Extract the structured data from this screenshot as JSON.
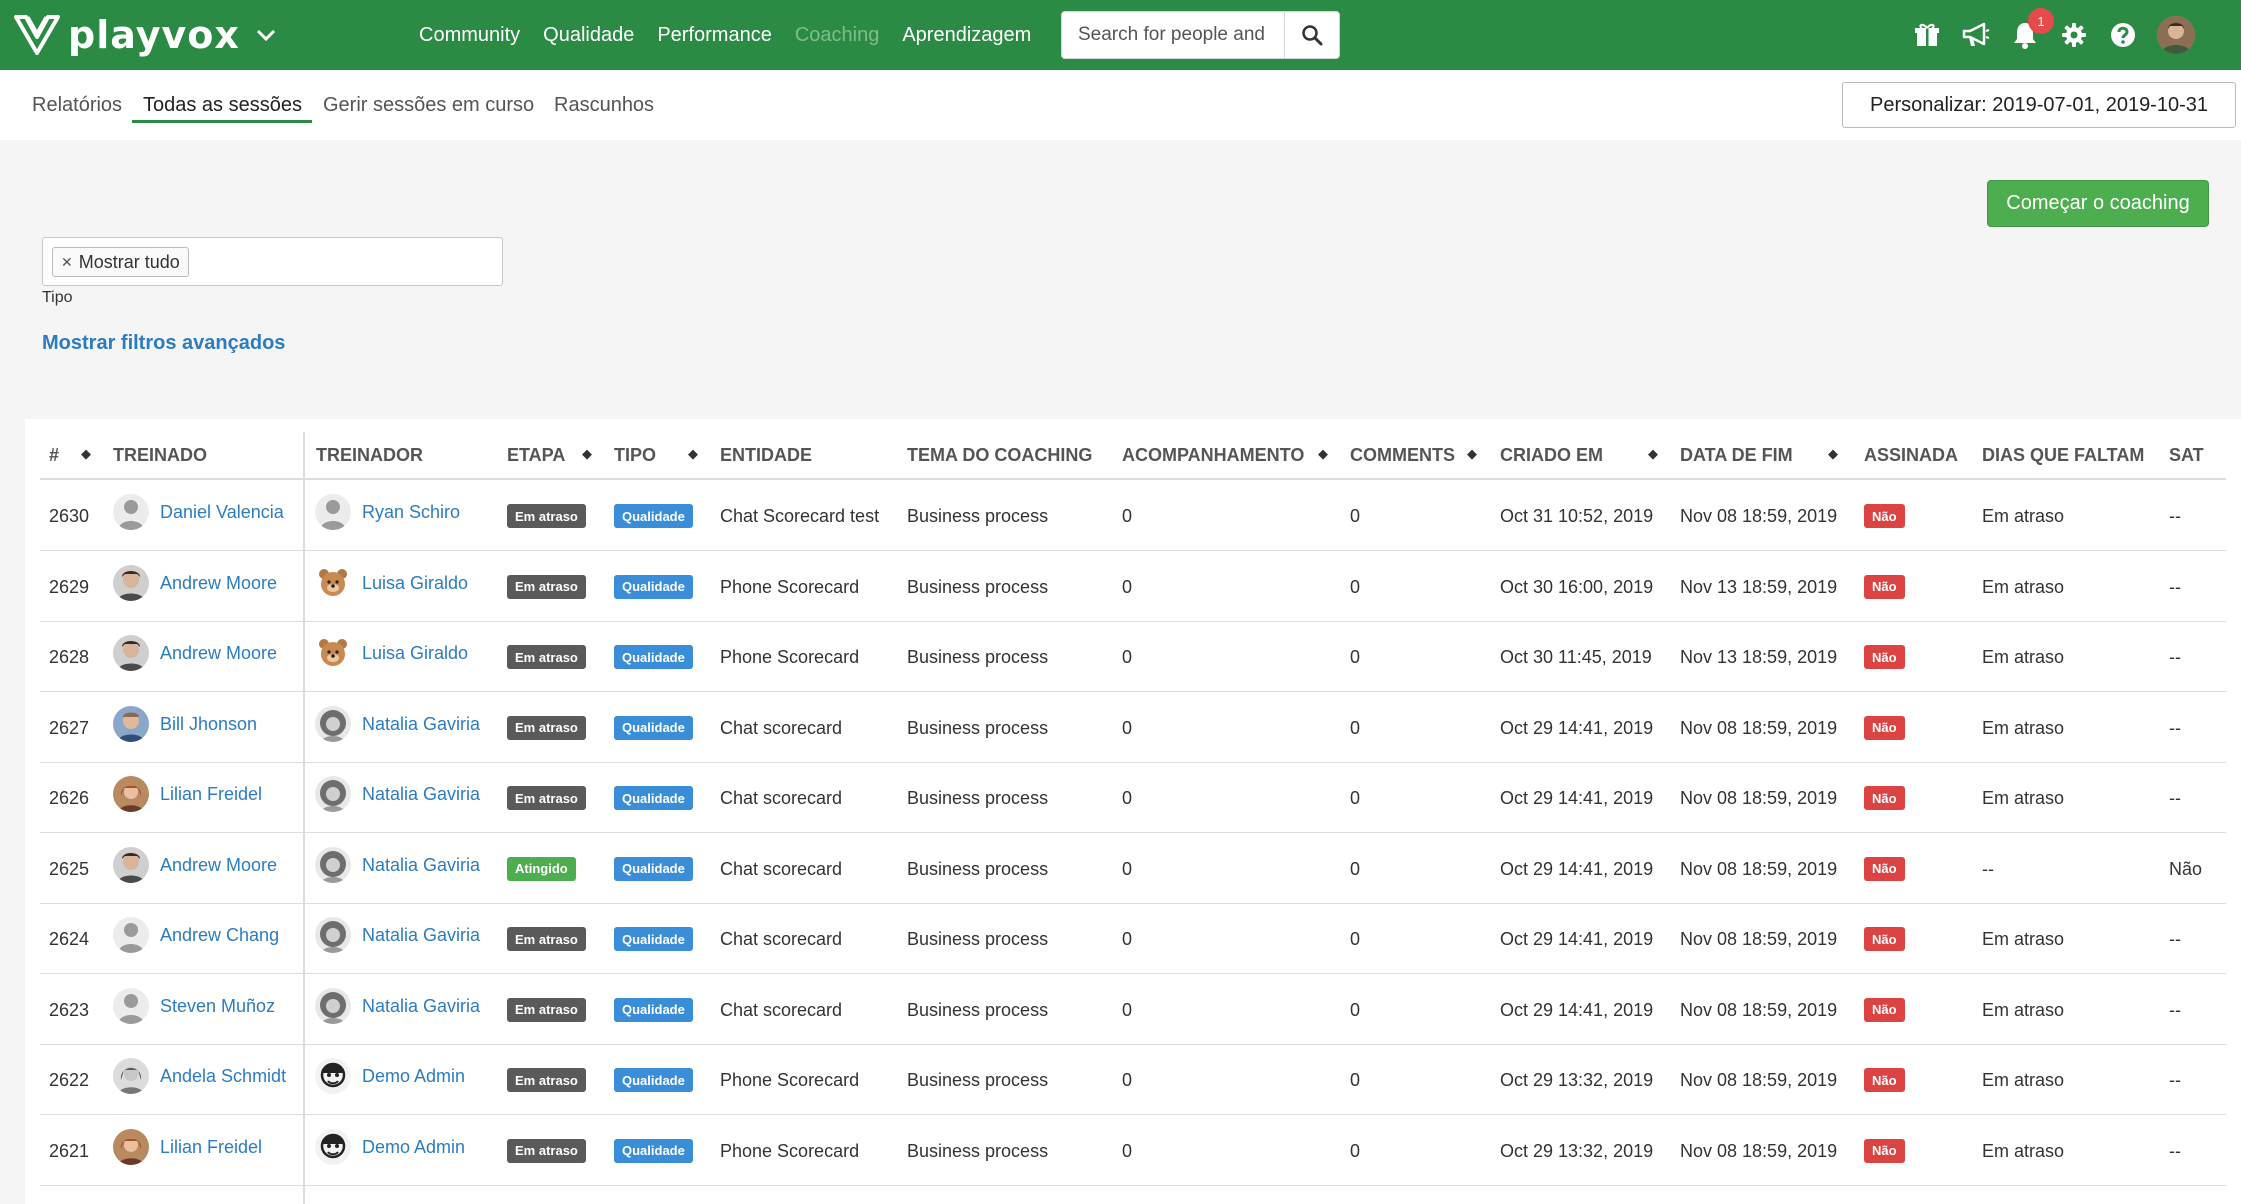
{
  "brand": {
    "name": "playvox"
  },
  "nav": {
    "items": [
      {
        "label": "Community"
      },
      {
        "label": "Qualidade"
      },
      {
        "label": "Performance"
      },
      {
        "label": "Coaching"
      },
      {
        "label": "Aprendizagem"
      }
    ]
  },
  "search": {
    "placeholder": "Search for people and"
  },
  "notifications": {
    "count": "1"
  },
  "subnav": {
    "tabs": [
      {
        "label": "Relatórios"
      },
      {
        "label": "Todas as sessões"
      },
      {
        "label": "Gerir sessões em curso"
      },
      {
        "label": "Rascunhos"
      }
    ],
    "date_range": "Personalizar: 2019-07-01, 2019-10-31"
  },
  "actions": {
    "start_coaching": "Começar o coaching"
  },
  "filters": {
    "chip_label": "Mostrar tudo",
    "type_label": "Tipo",
    "advanced_link": "Mostrar filtros avançados"
  },
  "table": {
    "headers": {
      "id": "#",
      "trainee": "TREINADO",
      "trainer": "TREINADOR",
      "stage": "ETAPA",
      "type": "TIPO",
      "entity": "ENTIDADE",
      "topic": "TEMA DO COACHING",
      "followup": "ACOMPANHAMENTO",
      "comments": "COMMENTS",
      "created": "CRIADO EM",
      "end_date": "DATA DE FIM",
      "signed": "ASSINADA",
      "days_left": "DIAS QUE FALTAM",
      "sat": "SAT"
    },
    "rows": [
      {
        "id": "2630",
        "trainee": "Daniel Valencia",
        "trainer": "Ryan Schiro",
        "stage": "Em atraso",
        "type": "Qualidade",
        "entity": "Chat Scorecard test",
        "topic": "Business process",
        "followup": "0",
        "comments": "0",
        "created": "Oct 31 10:52, 2019",
        "end_date": "Nov 08 18:59, 2019",
        "signed": "Não",
        "days_left": "Em atraso",
        "sat": "--"
      },
      {
        "id": "2629",
        "trainee": "Andrew Moore",
        "trainer": "Luisa Giraldo",
        "stage": "Em atraso",
        "type": "Qualidade",
        "entity": "Phone Scorecard",
        "topic": "Business process",
        "followup": "0",
        "comments": "0",
        "created": "Oct 30 16:00, 2019",
        "end_date": "Nov 13 18:59, 2019",
        "signed": "Não",
        "days_left": "Em atraso",
        "sat": "--"
      },
      {
        "id": "2628",
        "trainee": "Andrew Moore",
        "trainer": "Luisa Giraldo",
        "stage": "Em atraso",
        "type": "Qualidade",
        "entity": "Phone Scorecard",
        "topic": "Business process",
        "followup": "0",
        "comments": "0",
        "created": "Oct 30 11:45, 2019",
        "end_date": "Nov 13 18:59, 2019",
        "signed": "Não",
        "days_left": "Em atraso",
        "sat": "--"
      },
      {
        "id": "2627",
        "trainee": "Bill Jhonson",
        "trainer": "Natalia Gaviria",
        "stage": "Em atraso",
        "type": "Qualidade",
        "entity": "Chat scorecard",
        "topic": "Business process",
        "followup": "0",
        "comments": "0",
        "created": "Oct 29 14:41, 2019",
        "end_date": "Nov 08 18:59, 2019",
        "signed": "Não",
        "days_left": "Em atraso",
        "sat": "--"
      },
      {
        "id": "2626",
        "trainee": "Lilian Freidel",
        "trainer": "Natalia Gaviria",
        "stage": "Em atraso",
        "type": "Qualidade",
        "entity": "Chat scorecard",
        "topic": "Business process",
        "followup": "0",
        "comments": "0",
        "created": "Oct 29 14:41, 2019",
        "end_date": "Nov 08 18:59, 2019",
        "signed": "Não",
        "days_left": "Em atraso",
        "sat": "--"
      },
      {
        "id": "2625",
        "trainee": "Andrew Moore",
        "trainer": "Natalia Gaviria",
        "stage": "Atingido",
        "type": "Qualidade",
        "entity": "Chat scorecard",
        "topic": "Business process",
        "followup": "0",
        "comments": "0",
        "created": "Oct 29 14:41, 2019",
        "end_date": "Nov 08 18:59, 2019",
        "signed": "Não",
        "days_left": "--",
        "sat": "Não"
      },
      {
        "id": "2624",
        "trainee": "Andrew Chang",
        "trainer": "Natalia Gaviria",
        "stage": "Em atraso",
        "type": "Qualidade",
        "entity": "Chat scorecard",
        "topic": "Business process",
        "followup": "0",
        "comments": "0",
        "created": "Oct 29 14:41, 2019",
        "end_date": "Nov 08 18:59, 2019",
        "signed": "Não",
        "days_left": "Em atraso",
        "sat": "--"
      },
      {
        "id": "2623",
        "trainee": "Steven Muñoz",
        "trainer": "Natalia Gaviria",
        "stage": "Em atraso",
        "type": "Qualidade",
        "entity": "Chat scorecard",
        "topic": "Business process",
        "followup": "0",
        "comments": "0",
        "created": "Oct 29 14:41, 2019",
        "end_date": "Nov 08 18:59, 2019",
        "signed": "Não",
        "days_left": "Em atraso",
        "sat": "--"
      },
      {
        "id": "2622",
        "trainee": "Andela Schmidt",
        "trainer": "Demo Admin",
        "stage": "Em atraso",
        "type": "Qualidade",
        "entity": "Phone Scorecard",
        "topic": "Business process",
        "followup": "0",
        "comments": "0",
        "created": "Oct 29 13:32, 2019",
        "end_date": "Nov 08 18:59, 2019",
        "signed": "Não",
        "days_left": "Em atraso",
        "sat": "--"
      },
      {
        "id": "2621",
        "trainee": "Lilian Freidel",
        "trainer": "Demo Admin",
        "stage": "Em atraso",
        "type": "Qualidade",
        "entity": "Phone Scorecard",
        "topic": "Business process",
        "followup": "0",
        "comments": "0",
        "created": "Oct 29 13:32, 2019",
        "end_date": "Nov 08 18:59, 2019",
        "signed": "Não",
        "days_left": "Em atraso",
        "sat": "--"
      }
    ]
  },
  "colors": {
    "brand_green": "#2b8a43",
    "link_blue": "#2b7cc2",
    "overdue_gray": "#5a5a5a",
    "achieved_green": "#4cae4f",
    "type_blue": "#3a8ed8",
    "no_red": "#dc4444"
  },
  "icons": [
    "chevron-down-icon",
    "search-icon",
    "gift-icon",
    "megaphone-icon",
    "bell-icon",
    "gear-icon",
    "help-icon",
    "sort-icon",
    "avatar-icon"
  ]
}
